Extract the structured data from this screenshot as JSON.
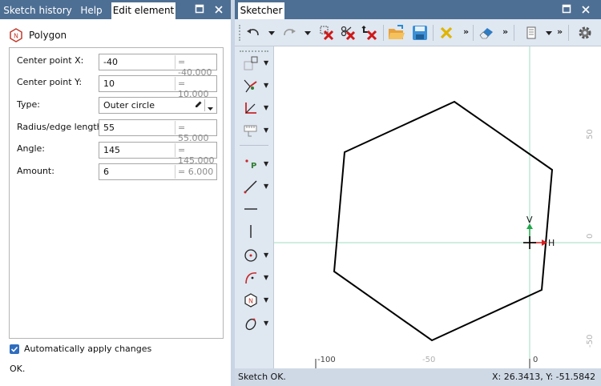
{
  "left_panel": {
    "tabs": [
      "Sketch history",
      "Help",
      "Edit element"
    ],
    "element_title": "Polygon",
    "fields": [
      {
        "label": "Center point X:",
        "value": "-40",
        "computed": "= -40.000"
      },
      {
        "label": "Center point Y:",
        "value": "10",
        "computed": "= 10.000"
      },
      {
        "label": "Type:",
        "value": "Outer circle"
      },
      {
        "label": "Radius/edge length:",
        "value": "55",
        "computed": "= 55.000"
      },
      {
        "label": "Angle:",
        "value": "145",
        "computed": "= 145.000"
      },
      {
        "label": "Amount:",
        "value": "6",
        "computed": "= 6.000"
      }
    ],
    "auto_apply_label": "Automatically apply changes",
    "auto_apply_checked": true,
    "status": "OK."
  },
  "sketcher": {
    "tab": "Sketcher",
    "x_ticks": [
      "-100",
      "-50",
      "0"
    ],
    "y_ticks": [
      "50",
      "0",
      "-50"
    ],
    "v_axis_label": "V",
    "h_axis_label": "H",
    "status_left": "Sketch OK.",
    "status_right": "X: 26.3413, Y: -51.5842"
  },
  "toolbar_icons": [
    "undo-icon",
    "redo-icon",
    "delete-icon",
    "cut-icon",
    "delete-selected-icon",
    "open-icon",
    "save-icon",
    "close-x-icon",
    "eraser-icon",
    "layers-icon",
    "settings-gear-icon"
  ],
  "side_tools": [
    "point-tools-icon",
    "constraint-icon",
    "dimension-icon",
    "measure-icon",
    "point-icon",
    "line-icon",
    "horizontal-line-icon",
    "vertical-line-icon",
    "circle-icon",
    "arc-icon",
    "polygon-icon",
    "ellipse-icon"
  ],
  "colors": {
    "tab_bar": "#4e6f94",
    "frame": "#c9d5e4",
    "axis": "#9fdcc0",
    "shape": "#000000"
  }
}
